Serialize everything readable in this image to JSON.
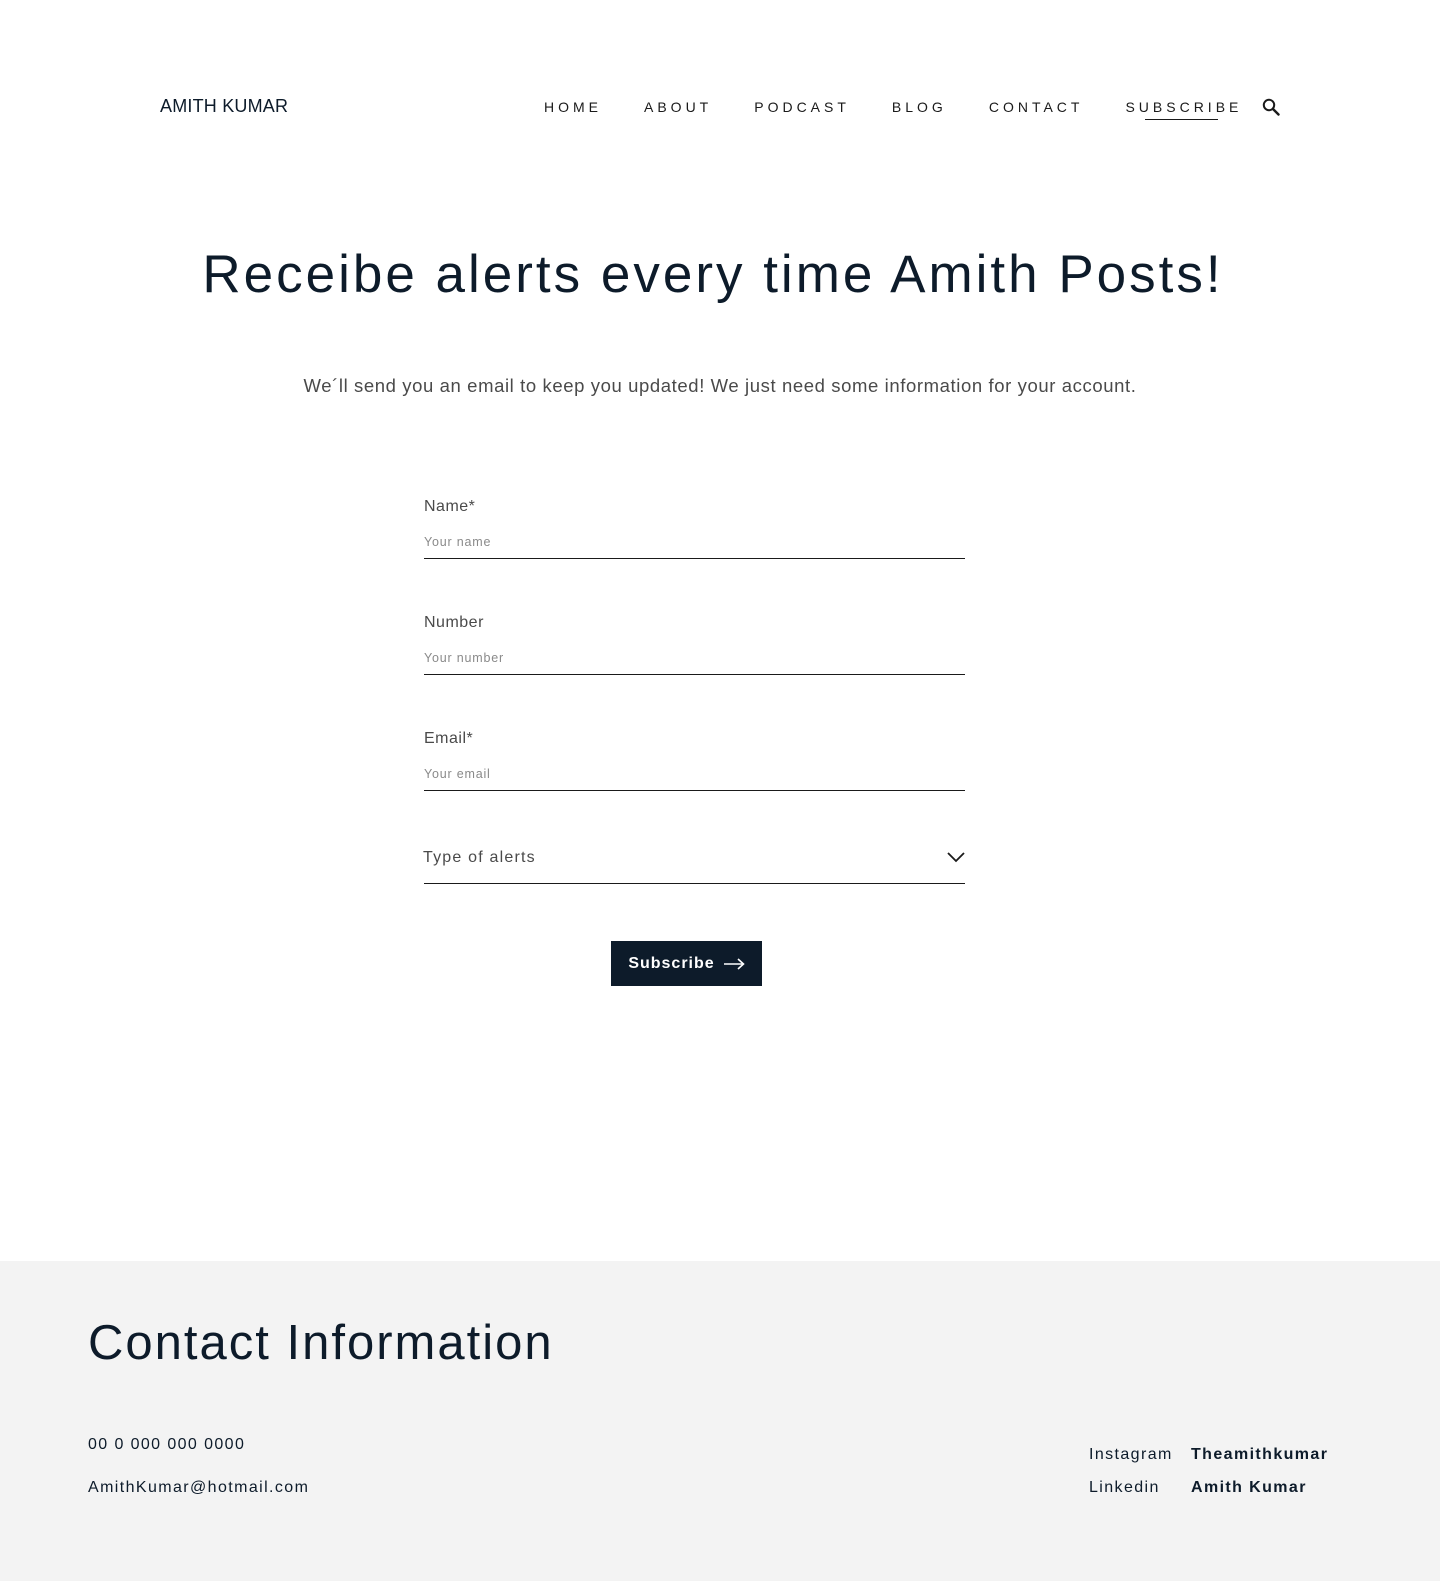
{
  "header": {
    "logo": "AMITH KUMAR",
    "nav": [
      "HOME",
      "ABOUT",
      "PODCAST",
      "BLOG",
      "CONTACT",
      "SUBSCRIBE"
    ],
    "active_nav": "SUBSCRIBE",
    "search_icon": "search-icon"
  },
  "hero": {
    "title": "Receibe alerts every time Amith Posts!",
    "subtitle": "We´ll send you an email to keep you updated! We just need some information for your account."
  },
  "form": {
    "name": {
      "label": "Name*",
      "placeholder": "Your name"
    },
    "number": {
      "label": "Number",
      "placeholder": "Your number"
    },
    "email": {
      "label": "Email*",
      "placeholder": "Your email"
    },
    "alerts": {
      "value": "Type of alerts",
      "icon": "chevron-down-icon"
    },
    "submit": {
      "label": "Subscribe",
      "icon": "arrow-right-icon"
    }
  },
  "footer": {
    "title": "Contact Information",
    "phone": "00 0 000 000 0000",
    "email": "AmithKumar@hotmail.com",
    "social": [
      {
        "label": "Instagram",
        "handle": "Theamithkumar"
      },
      {
        "label": "Linkedin",
        "handle": "Amith Kumar"
      }
    ]
  },
  "colors": {
    "primary": "#0d1b2a",
    "footer_bg": "#f3f3f3",
    "text_muted": "#4a4a4a"
  }
}
